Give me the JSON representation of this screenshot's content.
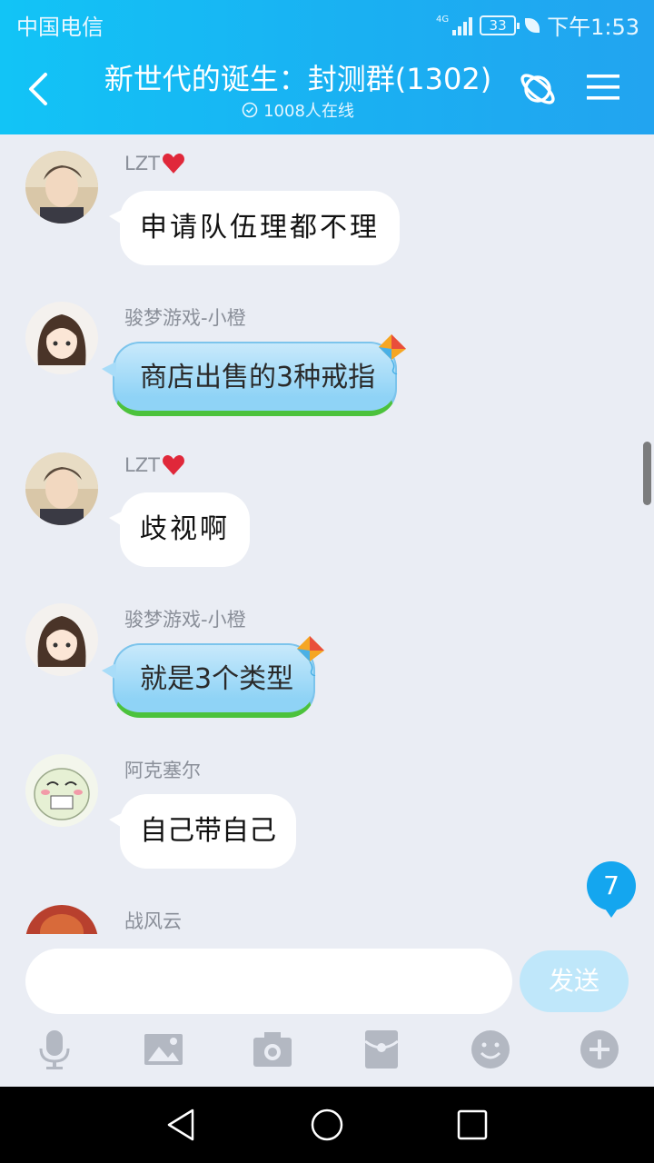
{
  "status_bar": {
    "carrier": "中国电信",
    "network": "4G",
    "battery": "33",
    "time": "下午1:53"
  },
  "header": {
    "title": "新世代的诞生：封测群(1302)",
    "online": "1008人在线"
  },
  "messages": [
    {
      "sender": "LZT",
      "has_heart": true,
      "text": "申请队伍理都不理",
      "style": "handwriting",
      "avatar": "boy-avatar"
    },
    {
      "sender": "骏梦游戏-小橙",
      "has_heart": false,
      "text": "商店出售的3种戒指",
      "style": "kite-bubble",
      "avatar": "girl-avatar"
    },
    {
      "sender": "LZT",
      "has_heart": true,
      "text": "歧视啊",
      "style": "handwriting",
      "avatar": "boy-avatar"
    },
    {
      "sender": "骏梦游戏-小橙",
      "has_heart": false,
      "text": "就是3个类型",
      "style": "kite-bubble",
      "avatar": "girl-avatar"
    },
    {
      "sender": "阿克塞尔",
      "has_heart": false,
      "text": "自己带自己",
      "style": "normal",
      "avatar": "cartoon-avatar"
    },
    {
      "sender": "战风云",
      "has_heart": false,
      "text": "",
      "style": "normal",
      "avatar": "red-avatar"
    }
  ],
  "unread_count": "7",
  "input": {
    "value": "",
    "send_label": "发送"
  },
  "toolbar": [
    "microphone-icon",
    "image-icon",
    "camera-icon",
    "red-packet-icon",
    "emoji-icon",
    "plus-icon"
  ],
  "colors": {
    "header_start": "#12c4f6",
    "header_end": "#22a4f0",
    "background": "#eaedf4",
    "send_disabled": "#bfe7fa",
    "badge": "#14a6ef"
  }
}
